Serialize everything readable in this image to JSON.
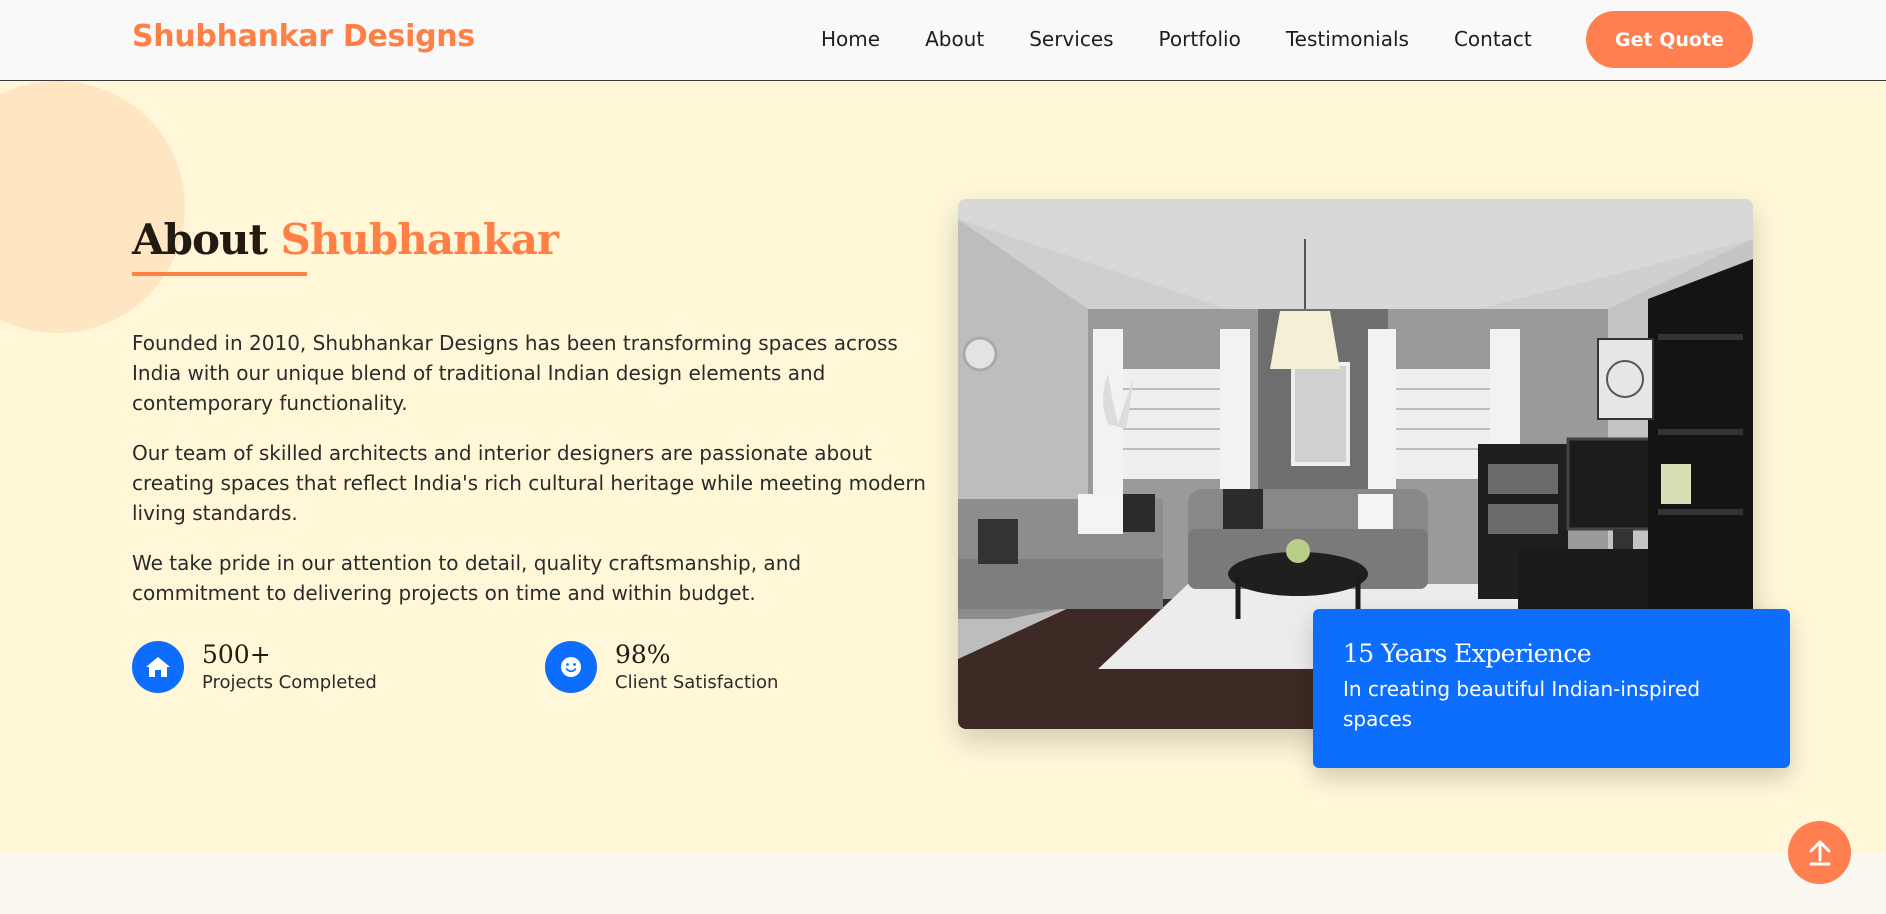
{
  "header": {
    "logo": "Shubhankar Designs",
    "nav": [
      "Home",
      "About",
      "Services",
      "Portfolio",
      "Testimonials",
      "Contact"
    ],
    "cta": "Get Quote"
  },
  "about": {
    "heading_main": "About",
    "heading_accent": "Shubhankar",
    "paragraphs": [
      "Founded in 2010, Shubhankar Designs has been transforming spaces across India with our unique blend of traditional Indian design elements and contemporary functionality.",
      "Our team of skilled architects and interior designers are passionate about creating spaces that reflect India's rich cultural heritage while meeting modern living standards.",
      "We take pride in our attention to detail, quality craftsmanship, and commitment to delivering projects on time and within budget."
    ],
    "stats": [
      {
        "number": "500+",
        "label": "Projects Completed",
        "icon": "home-icon"
      },
      {
        "number": "98%",
        "label": "Client Satisfaction",
        "icon": "smile-icon"
      }
    ],
    "experience": {
      "title": "15 Years Experience",
      "subtitle": "In creating beautiful Indian-inspired spaces"
    }
  },
  "colors": {
    "brand": "#ff7f45",
    "accent_blue": "#0d6efd",
    "section_bg": "#fff7d8"
  },
  "icons": {
    "scroll_top": "arrow-up-icon",
    "photo": "living-room-image"
  }
}
